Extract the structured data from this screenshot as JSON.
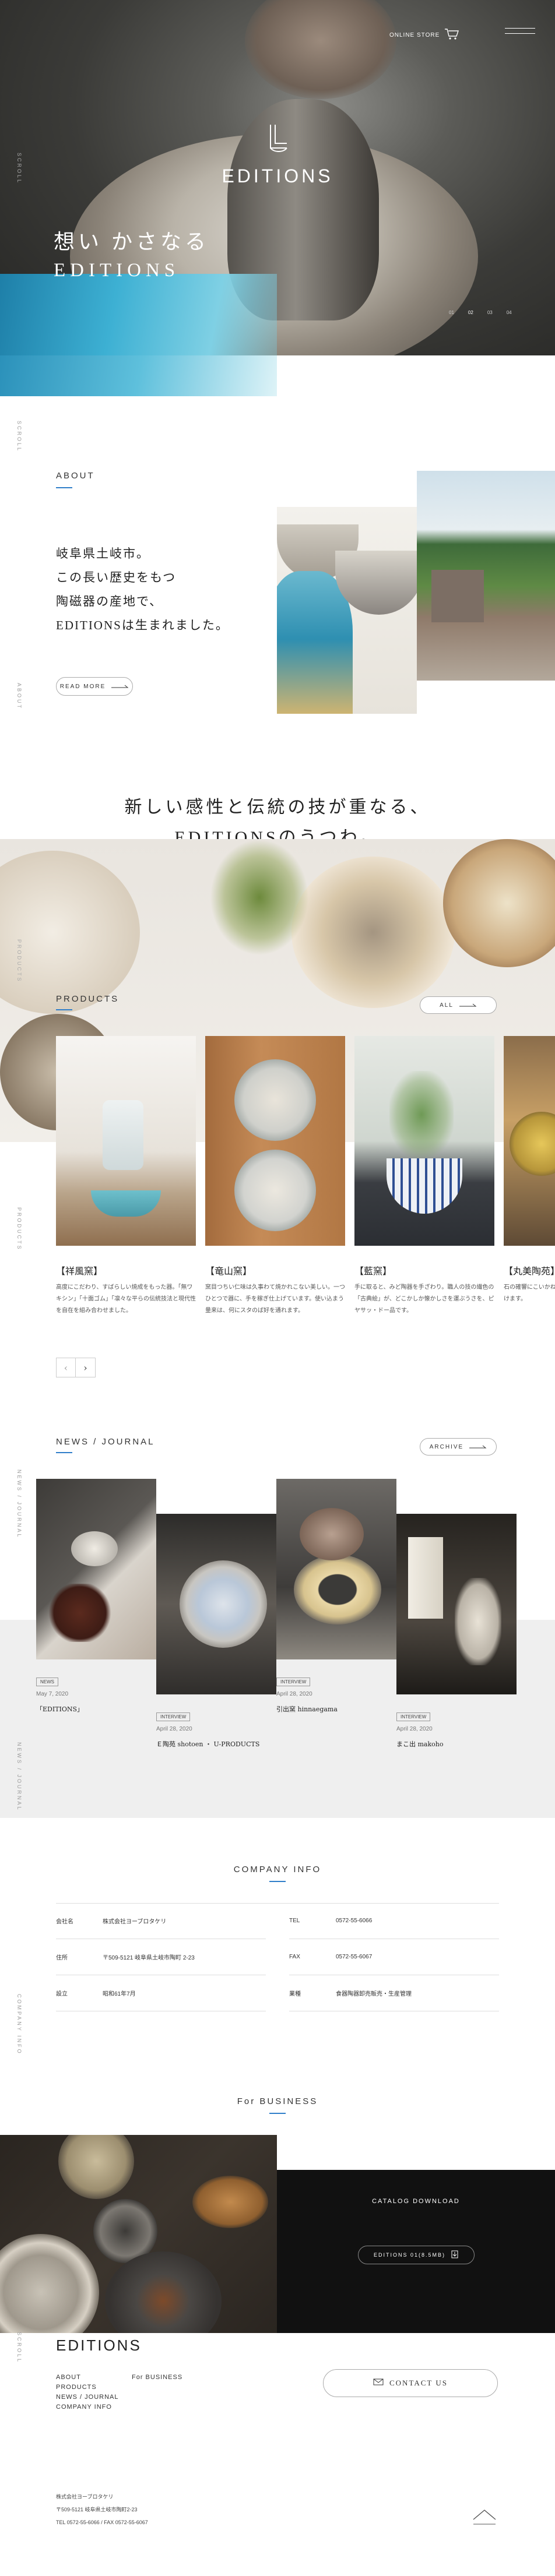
{
  "header": {
    "online_store": "ONLINE STORE",
    "icons": [
      "cart-icon",
      "hamburger-icon"
    ]
  },
  "hero": {
    "logo": "EDITIONS",
    "tagline_jp": "想い かさなる",
    "tagline_en": "EDITIONS",
    "scroll_label": "SCROLL",
    "slider_dots": [
      "01",
      "02",
      "03",
      "04"
    ]
  },
  "about": {
    "label": "ABOUT",
    "lines": [
      "岐阜県土岐市。",
      "この長い歴史をもつ",
      "陶磁器の産地で、",
      "EDITIONSは生まれました。"
    ],
    "button": "READ MORE",
    "side_label": "ABOUT"
  },
  "catch_copy": {
    "line1": "新しい感性と伝統の技が重なる、",
    "line2": "EDITIONSのうつわ。"
  },
  "products": {
    "label": "PRODUCTS",
    "filter": "ALL",
    "side_label": "PRODUCTS",
    "items": [
      {
        "name": "【祥風窯】",
        "desc": "高度にこだわり、すばらしい焼成をもった器。「無ワキシン」「十面ゴム」「凛々な平らの伝統技法と現代性を自在を組み合わせました。"
      },
      {
        "name": "【竜山窯】",
        "desc": "窯目つちい仁味は久事わて焼かれこない美しい。一つひとつで器に、手を稼ぎ仕上げています。使い込まう量来は、何にスタのば好を通れます。"
      },
      {
        "name": "【藍窯】",
        "desc": "手に取ると、みど陶器を手ざわり。職人の技の繊色の「古典絵」が、どこかしか懐かしさを運ぶうさを、ピヤサッ・ドー品です。"
      },
      {
        "name": "【丸美陶苑】",
        "desc": "石の確響にこいかね出る。引ワ出出ここは、引でゴムけます。"
      }
    ],
    "pager": [
      "‹",
      "›"
    ]
  },
  "news": {
    "label": "NEWS / JOURNAL",
    "archive": "ARCHIVE",
    "side_label": "NEWS / JOURNAL",
    "items": [
      {
        "tag": "NEWS",
        "date": "May 7, 2020",
        "title": "「EDITIONS」"
      },
      {
        "tag": "INTERVIEW",
        "date": "April 28, 2020",
        "title": "Ｅ陶苑 shotoen ・ U-PRODUCTS"
      },
      {
        "tag": "INTERVIEW",
        "date": "April 28, 2020",
        "title": "引出窯 hinnaegama"
      },
      {
        "tag": "INTERVIEW",
        "date": "April 28, 2020",
        "title": "まこ出 makoho"
      }
    ]
  },
  "company": {
    "label": "COMPANY INFO",
    "side_label": "COMPANY INFO",
    "left": [
      {
        "k": "会社名",
        "v": "株式会社ヨーブロタケリ"
      },
      {
        "k": "住所",
        "v": "〒509-5121 岐阜県土岐市陶町 2-23"
      },
      {
        "k": "設立",
        "v": "昭和61年7月"
      }
    ],
    "right": [
      {
        "k": "TEL",
        "v": "0572-55-6066"
      },
      {
        "k": "FAX",
        "v": "0572-55-6067"
      },
      {
        "k": "業種",
        "v": "食器陶器卸売販売・生産管理"
      }
    ]
  },
  "business": {
    "label": "For BUSINESS",
    "catalog_title": "CATALOG DOWNLOAD",
    "catalog_button": "EDITIONS 01(8.5MB)"
  },
  "footer": {
    "logo": "EDITIONS",
    "links_col1": [
      "ABOUT",
      "PRODUCTS",
      "NEWS / JOURNAL",
      "COMPANY INFO"
    ],
    "links_col2": [
      "For BUSINESS"
    ],
    "contact": "CONTACT US",
    "company": "株式会社ヨーブロタケリ",
    "address": "〒509-5121 岐阜県土岐市陶町2-23",
    "tel": "TEL 0572-55-6066 / FAX 0572-55-6067"
  },
  "colors": {
    "accent": "#2f7ec9",
    "dark": "#111111",
    "gray_bg": "#efefef"
  }
}
